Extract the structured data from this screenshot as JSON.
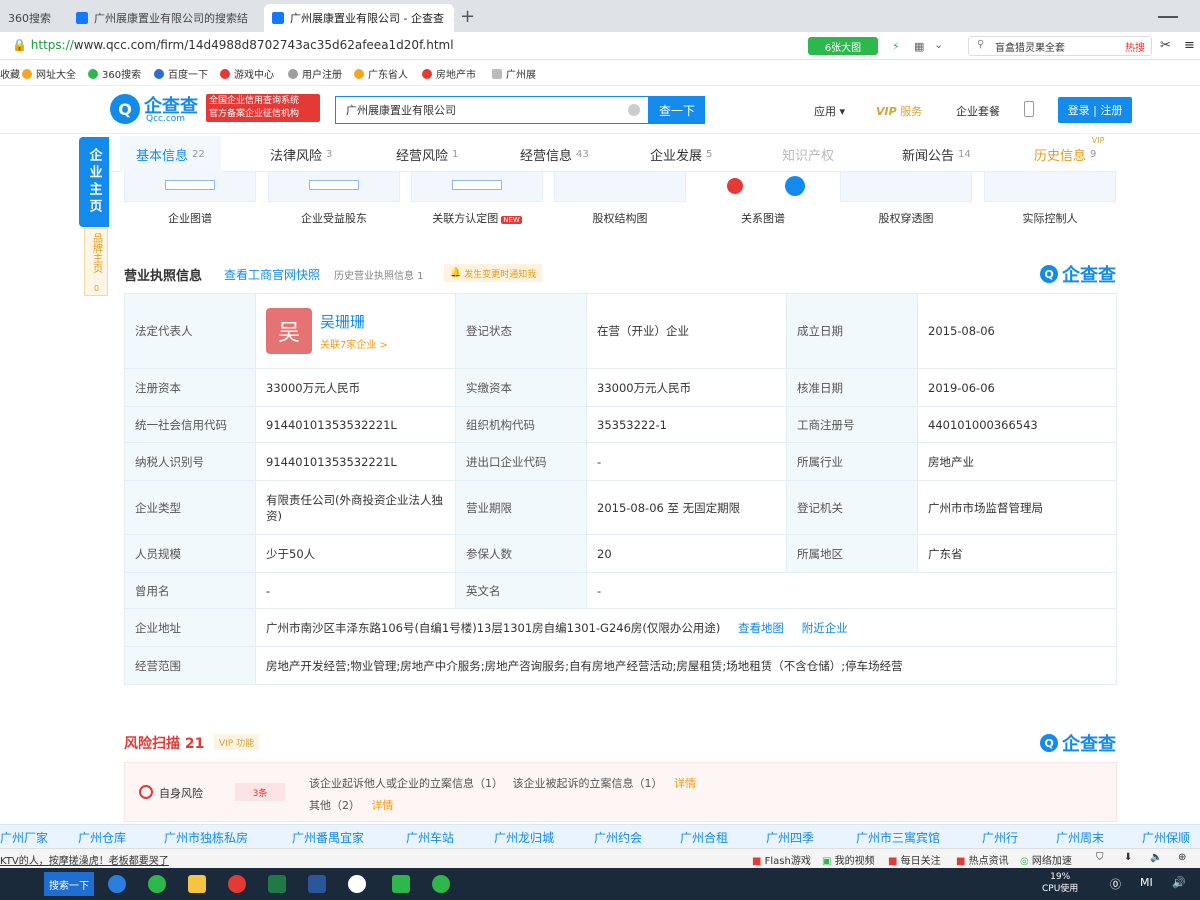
{
  "browser": {
    "tabs": [
      {
        "title": "360搜索"
      },
      {
        "title": "广州展康置业有限公司的搜索结"
      },
      {
        "title": "广州展康置业有限公司 - 企查查"
      }
    ],
    "url_scheme": "https://",
    "url_rest": "www.qcc.com/firm/14d4988d8702743ac35d62afeea1d20f.html",
    "bigpic_label": "6张大图",
    "search_placeholder": "盲盒猎灵果全套",
    "hot_label": "热搜",
    "bookmarks": [
      "收藏",
      "网址大全",
      "360搜索",
      "百度一下",
      "游戏中心",
      "用户注册",
      "广东省人",
      "房地产市",
      "广州展"
    ]
  },
  "site": {
    "logo_text": "企查查",
    "logo_sub": "Qcc.com",
    "badge_line1": "全国企业信用查询系统",
    "badge_line2": "官方备案企业征信机构",
    "search_value": "广州展康置业有限公司",
    "search_button": "查一下",
    "nav_app": "应用 ▾",
    "nav_vip": "VIP",
    "nav_vip_service": "服务",
    "nav_enterprise": "企业套餐",
    "login_label": "登录 | 注册"
  },
  "side": {
    "main_tab": "企业主页",
    "brand_tab": "品牌主页",
    "brand_count": "0"
  },
  "tabs": [
    {
      "label": "基本信息",
      "count": "22"
    },
    {
      "label": "法律风险",
      "count": "3"
    },
    {
      "label": "经营风险",
      "count": "1"
    },
    {
      "label": "经营信息",
      "count": "43"
    },
    {
      "label": "企业发展",
      "count": "5"
    },
    {
      "label": "知识产权",
      "count": ""
    },
    {
      "label": "新闻公告",
      "count": "14"
    },
    {
      "label": "历史信息",
      "count": "9"
    }
  ],
  "tabs_vip_tag": "VIP",
  "thumbnails": [
    {
      "caption": "企业图谱"
    },
    {
      "caption": "企业受益股东"
    },
    {
      "caption": "关联方认定图",
      "badge": "NEW"
    },
    {
      "caption": "股权结构图"
    },
    {
      "caption": "关系图谱"
    },
    {
      "caption": "股权穿透图"
    },
    {
      "caption": "实际控制人"
    }
  ],
  "license": {
    "title": "营业执照信息",
    "link": "查看工商官网快照",
    "history": "历史营业执照信息 1",
    "notify": "发生变更时通知我",
    "logo": "企查查",
    "legal_rep_key": "法定代表人",
    "legal_rep_avatar": "吴",
    "legal_rep_name": "吴珊珊",
    "legal_rep_related": "关联7家企业 >",
    "reg_status_key": "登记状态",
    "reg_status": "在营（开业）企业",
    "est_date_key": "成立日期",
    "est_date": "2015-08-06",
    "reg_capital_key": "注册资本",
    "reg_capital": "33000万元人民币",
    "paid_capital_key": "实缴资本",
    "paid_capital": "33000万元人民币",
    "approve_date_key": "核准日期",
    "approve_date": "2019-06-06",
    "credit_code_key": "统一社会信用代码",
    "credit_code": "91440101353532221L",
    "org_code_key": "组织机构代码",
    "org_code": "35353222-1",
    "biz_reg_key": "工商注册号",
    "biz_reg": "440101000366543",
    "taxpayer_key": "纳税人识别号",
    "taxpayer": "91440101353532221L",
    "import_export_key": "进出口企业代码",
    "import_export": "-",
    "industry_key": "所属行业",
    "industry": "房地产业",
    "type_key": "企业类型",
    "type": "有限责任公司(外商投资企业法人独资)",
    "term_key": "营业期限",
    "term": "2015-08-06 至 无固定期限",
    "authority_key": "登记机关",
    "authority": "广州市市场监督管理局",
    "staff_key": "人员规模",
    "staff": "少于50人",
    "insured_key": "参保人数",
    "insured": "20",
    "region_key": "所属地区",
    "region": "广东省",
    "former_name_key": "曾用名",
    "former_name": "-",
    "english_name_key": "英文名",
    "english_name": "-",
    "address_key": "企业地址",
    "address": "广州市南沙区丰泽东路106号(自编1号楼)13层1301房自编1301-G246房(仅限办公用途)",
    "map_link": "查看地图",
    "nearby_link": "附近企业",
    "scope_key": "经营范围",
    "scope": "房地产开发经营;物业管理;房地产中介服务;房地产咨询服务;自有房地产经营活动;房屋租赁;场地租赁（不含仓储）;停车场经营"
  },
  "risk": {
    "title": "风险扫描 21",
    "vip_badge": "VIP 功能",
    "logo": "企查查",
    "label": "自身风险",
    "count": "3条",
    "line1_a": "该企业起诉他人或企业的立案信息（1）",
    "line1_b": "该企业被起诉的立案信息（1）",
    "line1_detail": "详情",
    "line2_a": "其他（2）",
    "line2_detail": "详情"
  },
  "hot_searches": [
    "广州厂家",
    "广州仓库",
    "广州市独栋私房",
    "广州番禺宜家",
    "广州车站",
    "广州龙归城",
    "广州约会",
    "广州合租",
    "广州四季",
    "广州市三寓宾馆",
    "广州行",
    "广州周末",
    "广州保顺"
  ],
  "statusbar": {
    "news": "KTV的人，按摩搓澡虎！老板都要哭了",
    "items": [
      "Flash游戏",
      "我的视频",
      "每日关注",
      "热点资讯",
      "网络加速"
    ]
  },
  "taskbar": {
    "search": "搜索一下",
    "cpu_value": "19%",
    "cpu_label": "CPU使用",
    "mi": "MI"
  }
}
